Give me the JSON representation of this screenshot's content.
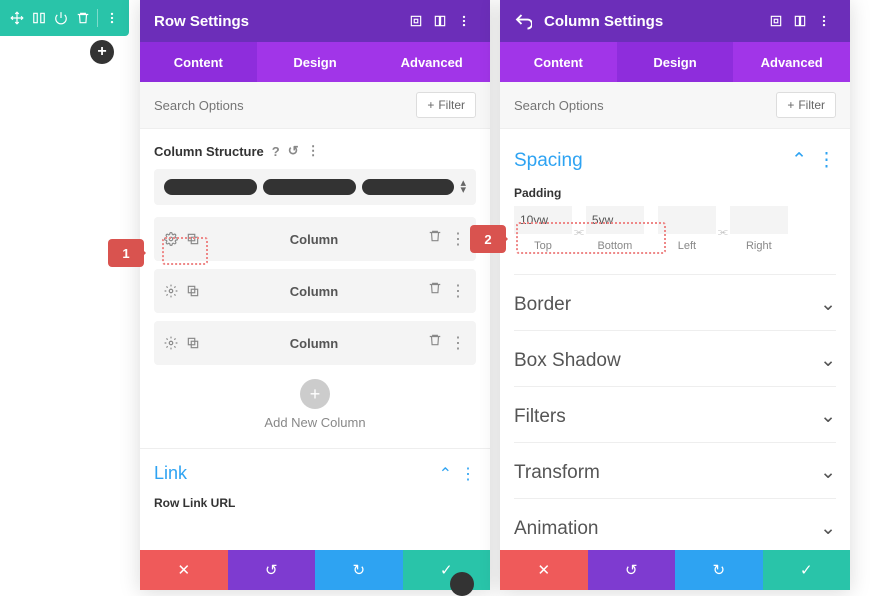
{
  "toolbar": {
    "plus": "+"
  },
  "leftPanel": {
    "title": "Row Settings",
    "tabs": [
      "Content",
      "Design",
      "Advanced"
    ],
    "activeTab": 0,
    "searchPlaceholder": "Search Options",
    "filterLabel": "Filter",
    "columnStructure": {
      "label": "Column Structure",
      "help": "?"
    },
    "columns": [
      {
        "label": "Column"
      },
      {
        "label": "Column"
      },
      {
        "label": "Column"
      }
    ],
    "addColumn": "Add New Column",
    "linkSection": {
      "title": "Link",
      "rowLinkLabel": "Row Link URL"
    }
  },
  "rightPanel": {
    "title": "Column Settings",
    "tabs": [
      "Content",
      "Design",
      "Advanced"
    ],
    "activeTab": 1,
    "searchPlaceholder": "Search Options",
    "filterLabel": "Filter",
    "spacing": {
      "title": "Spacing",
      "paddingLabel": "Padding",
      "fields": {
        "top": {
          "value": "10vw",
          "caption": "Top"
        },
        "bottom": {
          "value": "5vw",
          "caption": "Bottom"
        },
        "left": {
          "value": "",
          "caption": "Left"
        },
        "right": {
          "value": "",
          "caption": "Right"
        }
      }
    },
    "accordions": [
      "Border",
      "Box Shadow",
      "Filters",
      "Transform",
      "Animation"
    ]
  },
  "callouts": {
    "one": "1",
    "two": "2"
  },
  "footer": {
    "close": "✕",
    "undo": "↺",
    "redo": "↻",
    "check": "✓"
  }
}
